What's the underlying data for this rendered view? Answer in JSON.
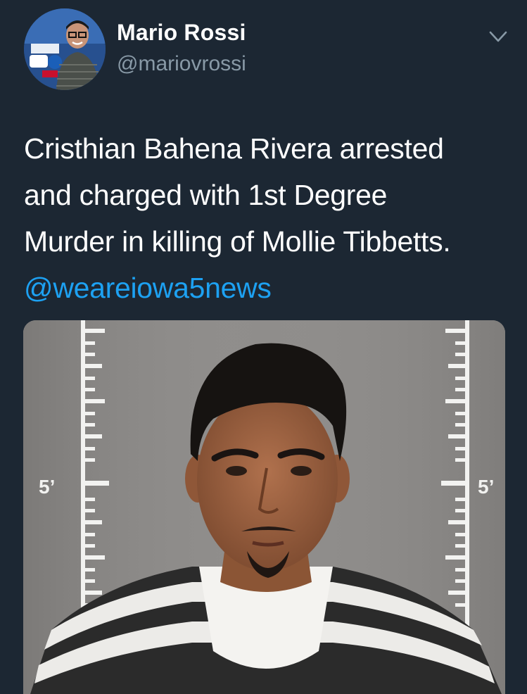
{
  "author": {
    "display_name": "Mario Rossi",
    "handle": "@mariovrossi",
    "avatar_icon": "profile-avatar"
  },
  "tweet": {
    "text_lines": [
      "Cristhian Bahena Rivera arrested",
      "and charged with 1st Degree",
      "Murder in killing of Mollie Tibbetts."
    ],
    "mention": "@weareiowa5news"
  },
  "media": {
    "height_marker_left": "5’",
    "height_marker_right": "5’"
  },
  "colors": {
    "background": "#1c2733",
    "handle": "#8899a6",
    "link": "#1da1f2"
  }
}
